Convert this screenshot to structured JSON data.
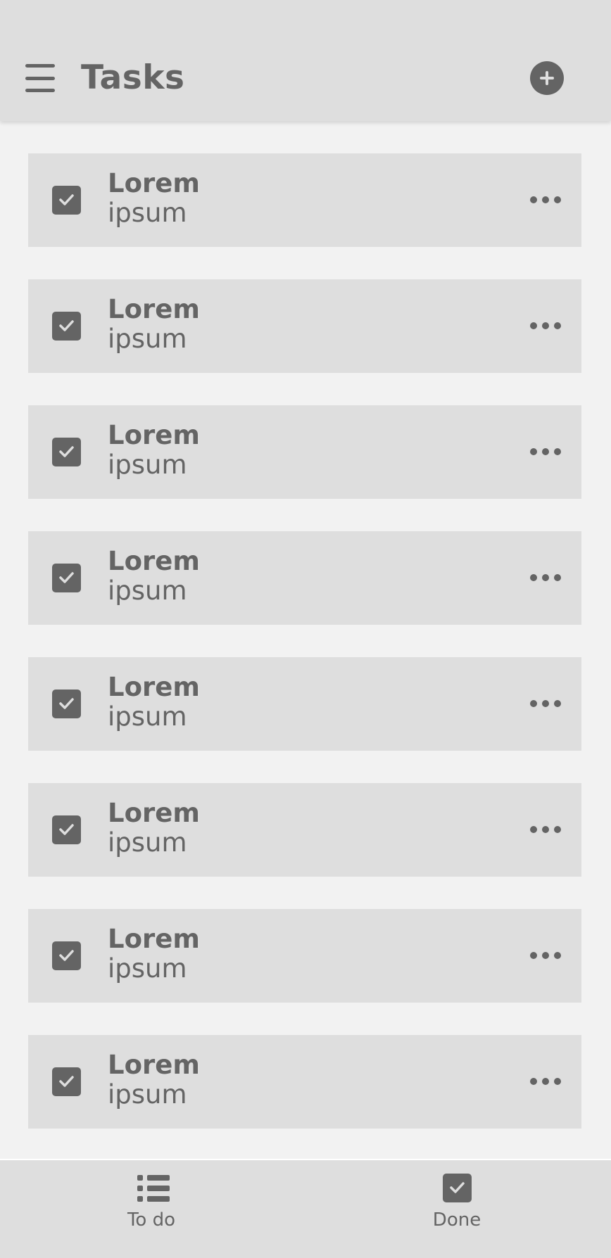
{
  "app_bar": {
    "title": "Tasks",
    "menu_icon": "hamburger-menu-icon",
    "add_icon": "plus-circle-icon"
  },
  "tasks": [
    {
      "title": "Lorem",
      "subtitle": "ipsum",
      "checked": true
    },
    {
      "title": "Lorem",
      "subtitle": "ipsum",
      "checked": true
    },
    {
      "title": "Lorem",
      "subtitle": "ipsum",
      "checked": true
    },
    {
      "title": "Lorem",
      "subtitle": "ipsum",
      "checked": true
    },
    {
      "title": "Lorem",
      "subtitle": "ipsum",
      "checked": true
    },
    {
      "title": "Lorem",
      "subtitle": "ipsum",
      "checked": true
    },
    {
      "title": "Lorem",
      "subtitle": "ipsum",
      "checked": true
    },
    {
      "title": "Lorem",
      "subtitle": "ipsum",
      "checked": true
    }
  ],
  "task_icons": {
    "checkbox": "checkbox-checked-icon",
    "more": "more-horizontal-icon"
  },
  "bottom_nav": {
    "items": [
      {
        "label": "To do",
        "icon": "list-icon"
      },
      {
        "label": "Done",
        "icon": "checkbox-checked-icon"
      }
    ]
  },
  "colors": {
    "bar_background": "#dedede",
    "page_background": "#f2f2f2",
    "card_background": "#dedede",
    "foreground": "#646464"
  }
}
